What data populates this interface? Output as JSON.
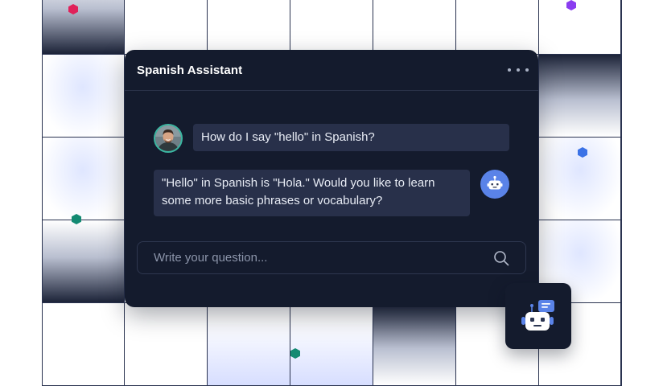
{
  "chat": {
    "title": "Spanish Assistant",
    "messages": [
      {
        "role": "user",
        "text": "How do I say \"hello\" in Spanish?"
      },
      {
        "role": "assistant",
        "text": " \"Hello\" in Spanish is \"Hola.\" Would you like to learn\nsome more basic phrases or vocabulary?"
      }
    ],
    "input_placeholder": "Write your question...",
    "input_value": ""
  },
  "icons": {
    "more": "more-horizontal-icon",
    "search": "search-icon",
    "bot": "robot-icon",
    "chat_bot": "robot-chat-icon"
  },
  "colors": {
    "panel_bg": "#141b2d",
    "bubble_bg": "#28304a",
    "bot_avatar": "#5a83e8",
    "user_avatar_ring": "#3bb7a2",
    "grid_line": "#2a3350",
    "hex_red": "#e0215a",
    "hex_purple": "#8a3df0",
    "hex_blue": "#3b72e6",
    "hex_teal": "#138a72"
  }
}
